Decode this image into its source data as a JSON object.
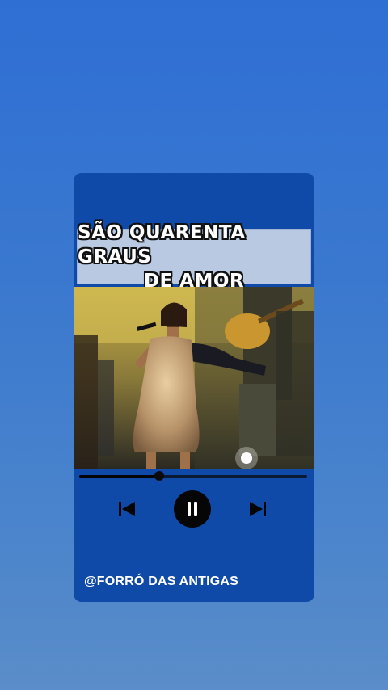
{
  "card": {
    "title_lines": [
      "SÃO QUARENTA GRAUS",
      "DE AMOR"
    ],
    "channel": "@FORRÓ DAS ANTIGAS"
  },
  "player": {
    "progress": 0.35,
    "state": "playing",
    "icons": [
      "skip-previous-icon",
      "pause-icon",
      "skip-next-icon"
    ]
  },
  "colors": {
    "background": "#3a78cf",
    "card": "#0f4aa8",
    "title_box": "#b9c9e2",
    "control_bg": "#060606"
  }
}
